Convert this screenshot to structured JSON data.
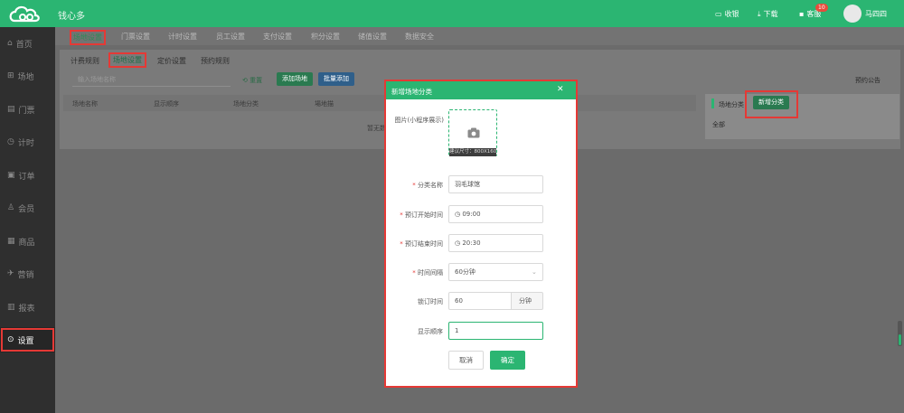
{
  "app": {
    "name": "钱心多",
    "brand_color": "#2bb572",
    "alert_color": "#e53935"
  },
  "topbar": {
    "items": [
      {
        "icon": "monitor-icon",
        "label": "收银"
      },
      {
        "icon": "download-icon",
        "label": "下载"
      },
      {
        "icon": "message-icon",
        "label": "客服",
        "badge": "10"
      }
    ],
    "username": "马四四"
  },
  "sidebar": {
    "items": [
      {
        "icon": "home-icon",
        "label": "首页"
      },
      {
        "icon": "venue-icon",
        "label": "场地"
      },
      {
        "icon": "ticket-icon",
        "label": "门票"
      },
      {
        "icon": "clock-icon",
        "label": "计时"
      },
      {
        "icon": "order-icon",
        "label": "订单"
      },
      {
        "icon": "member-icon",
        "label": "会员"
      },
      {
        "icon": "shop-icon",
        "label": "商品"
      },
      {
        "icon": "marketing-icon",
        "label": "营销"
      },
      {
        "icon": "report-icon",
        "label": "报表"
      },
      {
        "icon": "settings-icon",
        "label": "设置"
      }
    ]
  },
  "main_tabs": [
    "场地设置",
    "门票设置",
    "计时设置",
    "员工设置",
    "支付设置",
    "积分设置",
    "储值设置",
    "数据安全"
  ],
  "sub_tabs": [
    "计费规则",
    "场地设置",
    "定价设置",
    "预约规则"
  ],
  "toolbar": {
    "search_placeholder": "输入场地名称",
    "reset": "重置",
    "add_field": "添加场地",
    "batch_add": "批量添加",
    "right_link": "预约公告"
  },
  "table": {
    "headers": [
      "场地名称",
      "显示顺序",
      "场地分类",
      "場地描"
    ],
    "empty": "暂无数据"
  },
  "right_panel": {
    "label": "场地分类：",
    "button": "新增分类",
    "item": "全部"
  },
  "modal": {
    "title": "新增场地分类",
    "image_label": "图片(小程序展示)",
    "image_hint": "建议尺寸：800X160",
    "fields": [
      {
        "label": "分类名称",
        "required": true,
        "value": "羽毛球馆"
      },
      {
        "label": "预订开始时间",
        "required": true,
        "value": "09:00",
        "icon": "clock-icon"
      },
      {
        "label": "预订结束时间",
        "required": true,
        "value": "20:30",
        "icon": "clock-icon"
      },
      {
        "label": "时间间隔",
        "required": true,
        "value": "60分钟"
      },
      {
        "label": "锁订时间",
        "required": false,
        "value": "60",
        "suffix": "分钟"
      },
      {
        "label": "显示顺序",
        "required": false,
        "value": "1"
      }
    ],
    "cancel": "取消",
    "confirm": "确定"
  }
}
